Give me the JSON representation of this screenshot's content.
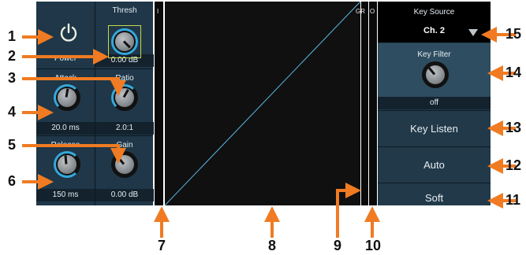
{
  "left_panel": {
    "power": {
      "label": "Power"
    },
    "thresh": {
      "title": "Thresh",
      "value": "0.00 dB"
    },
    "attack": {
      "title": "Attack",
      "value": "20.0 ms"
    },
    "ratio": {
      "title": "Ratio",
      "value": "2.0:1"
    },
    "release": {
      "title": "Release",
      "value": "150 ms"
    },
    "gain": {
      "title": "Gain",
      "value": "0.00 dB"
    }
  },
  "meters": {
    "input_label": "I",
    "gr_label": "GR",
    "output_label": "O"
  },
  "key_source": {
    "title": "Key Source",
    "value": "Ch. 2"
  },
  "key_filter": {
    "title": "Key Filter",
    "value": "off"
  },
  "buttons": {
    "key_listen": "Key Listen",
    "auto": "Auto",
    "soft": "Soft"
  },
  "callouts": [
    "1",
    "2",
    "3",
    "4",
    "5",
    "6",
    "7",
    "8",
    "9",
    "10",
    "11",
    "12",
    "13",
    "14",
    "15"
  ],
  "colors": {
    "accent_orange": "#f07b22",
    "panel": "#1f3748",
    "ring": "#35a8dc",
    "thresh_highlight": "#c7d84a"
  }
}
